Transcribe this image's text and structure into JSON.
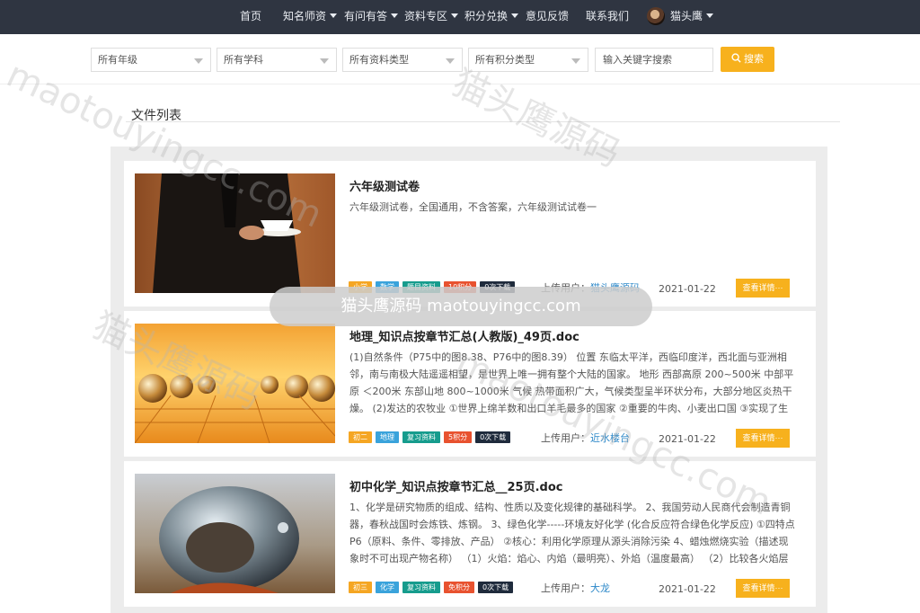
{
  "nav": {
    "items": [
      {
        "label": "首页",
        "dropdown": false
      },
      {
        "label": "知名师资",
        "dropdown": true
      },
      {
        "label": "有问有答",
        "dropdown": true
      },
      {
        "label": "资料专区",
        "dropdown": true
      },
      {
        "label": "积分兑换",
        "dropdown": true
      },
      {
        "label": "意见反馈",
        "dropdown": false
      },
      {
        "label": "联系我们",
        "dropdown": false
      }
    ],
    "user": {
      "name": "猫头鹰"
    }
  },
  "filters": {
    "grade": "所有年级",
    "subject": "所有学科",
    "material_type": "所有资料类型",
    "points_type": "所有积分类型",
    "keyword_placeholder": "输入关键字搜索",
    "search_label": "搜索"
  },
  "section": {
    "title": "文件列表"
  },
  "files": [
    {
      "title": "六年级测试卷",
      "description": "六年级测试卷，全国通用，不含答案，六年级测试试卷一",
      "tags": {
        "grade": "小学",
        "subject": "数学",
        "type": "题目资料",
        "points": "10积分",
        "downloads": "0次下载"
      },
      "uploader_label": "上传用户：",
      "uploader": "猫头鹰源码",
      "date": "2021-01-22",
      "detail_label": "查看详情···"
    },
    {
      "title": "地理_知识点按章节汇总(人教版)_49页.doc",
      "description": "(1)自然条件（P75中的图8.38、P76中的图8.39） 位置 东临太平洋，西临印度洋，西北面与亚洲相邻，南与南极大陆遥遥相望，是世界上唯一拥有整个大陆的国家。 地形 西部高原 200~500米 中部平原 ＜200米 东部山地 800~1000米 气候 热带面积广大，气候类型呈半环状分布，大部分地区炎热干燥。 (2)发达的农牧业 ①世界上绵羊数和出口羊毛最多的国家 ②重要的牛肉、小麦出口国 ③实现了生产机械化 (3)澳大利亚农牧...",
      "tags": {
        "grade": "初二",
        "subject": "地理",
        "type": "复习资料",
        "points": "5积分",
        "downloads": "0次下载"
      },
      "uploader_label": "上传用户：",
      "uploader": "近水楼台",
      "date": "2021-01-22",
      "detail_label": "查看详情···"
    },
    {
      "title": "初中化学_知识点按章节汇总__25页.doc",
      "description": "1、化学是研究物质的组成、结构、性质以及变化规律的基础科学。 2、我国劳动人民商代会制造青铜器，春秋战国时会炼铁、炼钢。 3、绿色化学-----环境友好化学 (化合反应符合绿色化学反应) ①四特点P6（原料、条件、零排放、产品） ②核心：利用化学原理从源头消除污染 4、蜡烛燃烧实验（描述现象时不可出现产物名称） （1）火焰：焰心、内焰（最明亮）、外焰（温度最高） （2）比较各火焰层温度：用一火柴...",
      "tags": {
        "grade": "初三",
        "subject": "化学",
        "type": "复习资料",
        "points": "免积分",
        "downloads": "0次下载"
      },
      "uploader_label": "上传用户：",
      "uploader": "大龙",
      "date": "2021-01-22",
      "detail_label": "查看详情···"
    }
  ],
  "watermark": {
    "text_cn": "猫头鹰源码",
    "text_url": "maotouyingcc.com",
    "banner": "猫头鹰源码 maotouyingcc.com"
  },
  "colors": {
    "nav_bg": "#2f3541",
    "accent": "#f7b11d",
    "link": "#2b87c8"
  }
}
